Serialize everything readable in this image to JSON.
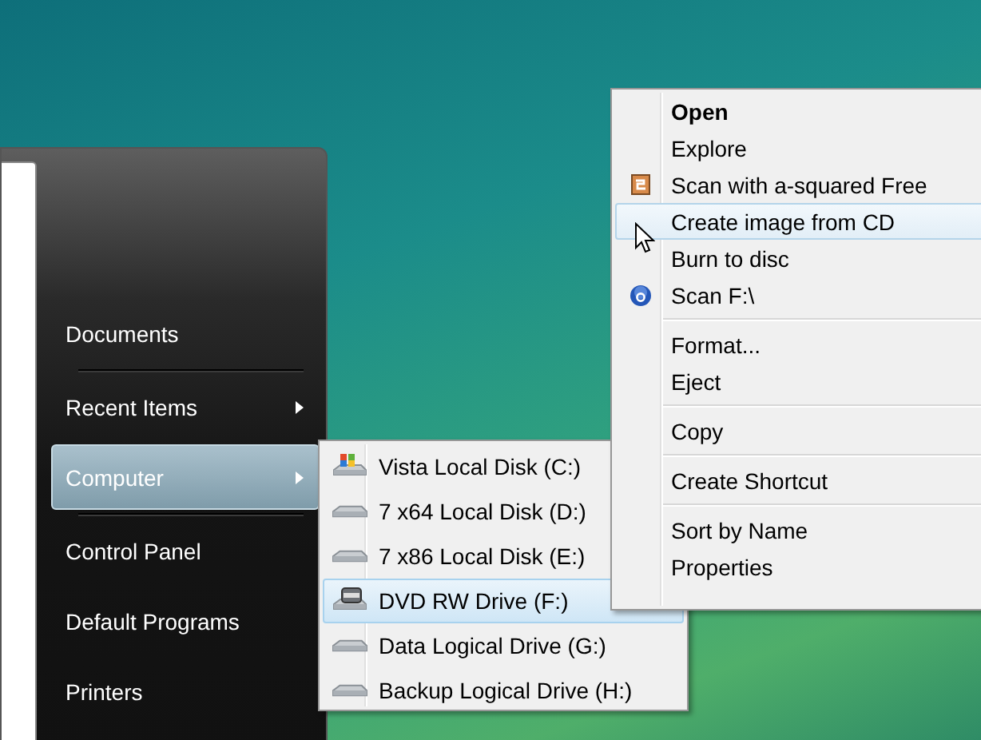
{
  "start_menu": {
    "items": [
      {
        "kind": "item",
        "label": "Documents",
        "has_submenu": false,
        "selected": false
      },
      {
        "kind": "separator"
      },
      {
        "kind": "item",
        "label": "Recent Items",
        "has_submenu": true,
        "selected": false
      },
      {
        "kind": "item",
        "label": "Computer",
        "has_submenu": true,
        "selected": true
      },
      {
        "kind": "separator"
      },
      {
        "kind": "item",
        "label": "Control Panel",
        "has_submenu": false,
        "selected": false
      },
      {
        "kind": "item",
        "label": "Default Programs",
        "has_submenu": false,
        "selected": false
      },
      {
        "kind": "item",
        "label": "Printers",
        "has_submenu": false,
        "selected": false
      }
    ]
  },
  "drives_menu": {
    "items": [
      {
        "label": "Vista Local Disk (C:)",
        "kind": "system",
        "selected": false
      },
      {
        "label": "7 x64 Local Disk (D:)",
        "kind": "disk",
        "selected": false
      },
      {
        "label": "7 x86 Local Disk (E:)",
        "kind": "disk",
        "selected": false
      },
      {
        "label": "DVD RW Drive (F:)",
        "kind": "dvd",
        "selected": true
      },
      {
        "label": "Data Logical Drive (G:)",
        "kind": "disk",
        "selected": false
      },
      {
        "label": "Backup Logical Drive (H:)",
        "kind": "disk",
        "selected": false
      }
    ]
  },
  "context_menu": {
    "items": [
      {
        "kind": "plain",
        "label": "Open",
        "default": true,
        "selected": false
      },
      {
        "kind": "plain",
        "label": "Explore",
        "default": false,
        "selected": false
      },
      {
        "kind": "scanner",
        "label": "Scan with a-squared Free",
        "default": false,
        "selected": false
      },
      {
        "kind": "plain",
        "label": "Create image from CD",
        "default": false,
        "selected": true
      },
      {
        "kind": "plain",
        "label": "Burn to disc",
        "default": false,
        "selected": false
      },
      {
        "kind": "antivirus",
        "label": "Scan F:\\",
        "default": false,
        "selected": false
      },
      {
        "kind": "separator"
      },
      {
        "kind": "plain",
        "label": "Format...",
        "default": false,
        "selected": false
      },
      {
        "kind": "plain",
        "label": "Eject",
        "default": false,
        "selected": false
      },
      {
        "kind": "separator"
      },
      {
        "kind": "plain",
        "label": "Copy",
        "default": false,
        "selected": false
      },
      {
        "kind": "separator"
      },
      {
        "kind": "plain",
        "label": "Create Shortcut",
        "default": false,
        "selected": false
      },
      {
        "kind": "separator"
      },
      {
        "kind": "plain",
        "label": "Sort by Name",
        "default": false,
        "selected": false
      },
      {
        "kind": "plain",
        "label": "Properties",
        "default": false,
        "selected": false
      }
    ]
  }
}
